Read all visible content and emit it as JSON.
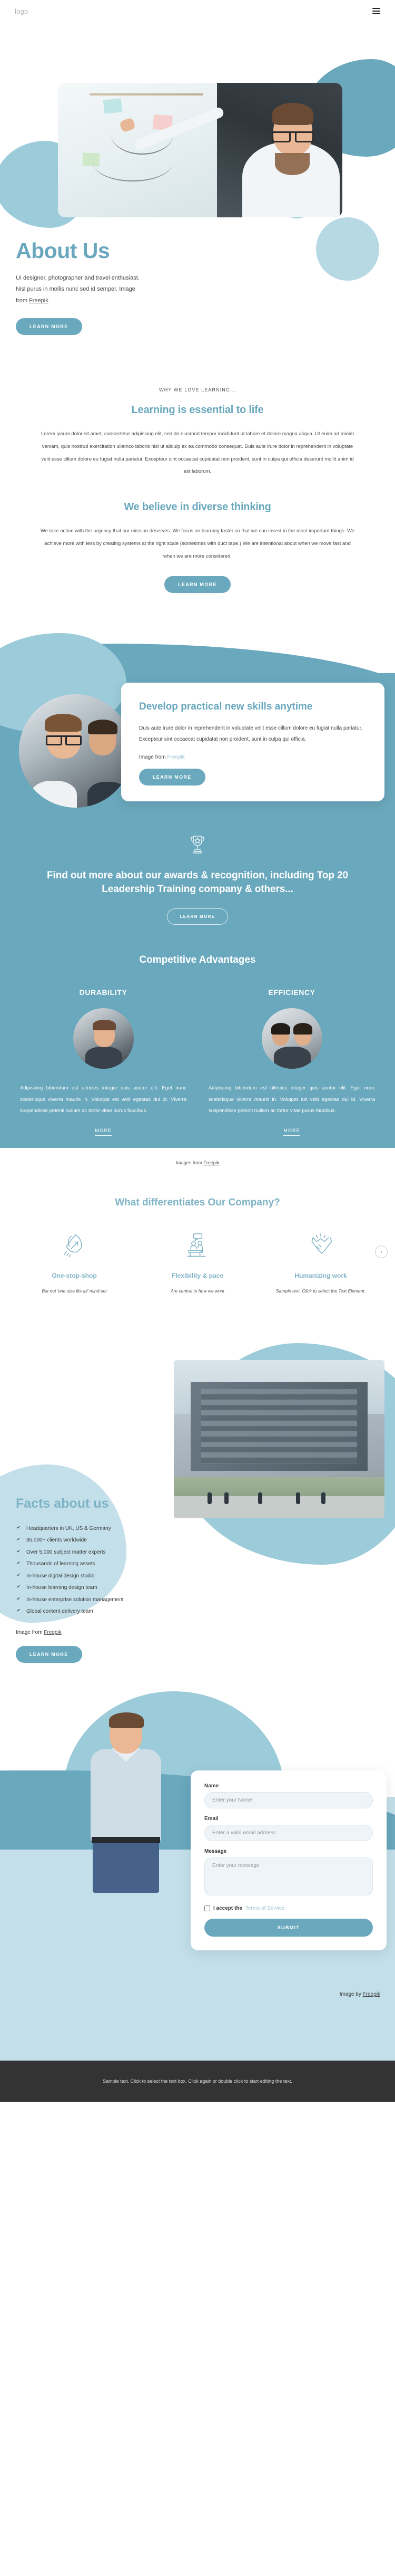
{
  "header": {
    "logo": "logo",
    "menu_icon": "hamburger-menu"
  },
  "hero": {
    "title": "About Us",
    "text_before_link": "UI designer, photographer and travel enthusiast. Nisl purus in mollis nunc sed id semper.  Image from ",
    "link": "Freepik",
    "cta": "LEARN MORE"
  },
  "why": {
    "eyebrow": "WHY WE LOVE LEARNING...",
    "title": "Learning is essential to life",
    "body": "Lorem ipsum dolor sit amet, consectetur adipiscing elit, sed do eiusmod tempor incididunt ut labore et dolore magna aliqua. Ut enim ad minim veniam, quis nostrud exercitation ullamco laboris nisi ut aliquip ex ea commodo consequat. Duis aute irure dolor in reprehenderit in voluptate velit esse cillum dolore eu fugiat nulla pariatur. Excepteur sint occaecat cupidatat non proident, sunt in culpa qui officia deserunt mollit anim id est laborum."
  },
  "believe": {
    "title": "We believe in diverse thinking",
    "body": "We take action with the urgency that our mission deserves. We focus on learning faster so that we can invest in the most important things. We achieve more with less by creating systems at the right scale (sometimes with duct tape.) We are intentional about when we move fast and when we are more considered.",
    "cta": "LEARN MORE"
  },
  "skills": {
    "title": "Develop practical new skills anytime",
    "body": "Duis aute irure dolor in reprehenderit in voluptate velit esse cillum dolore eu fugiat nulla pariatur. Excepteur sint occaecat cupidatat non proident, sunt in culpa qui officia.",
    "credit_prefix": "Image from ",
    "credit_link": "Freepik",
    "cta": "LEARN MORE"
  },
  "awards": {
    "icon": "trophy-icon",
    "title": "Find out more about our awards & recognition, including Top 20 Leadership Training company & others...",
    "cta": "LEARN MORE"
  },
  "competitive": {
    "title": "Competitive Advantages",
    "columns": [
      {
        "heading": "DURABILITY",
        "body": "Adipiscing bibendum est ultricies integer quis auctor elit. Eget nunc scelerisque viverra mauris in. Volutpat est velit egestas dui id. Viverra suspendisse potenti nullam ac tortor vitae purus faucibus.",
        "more": "MORE"
      },
      {
        "heading": "EFFICIENCY",
        "body": "Adipiscing bibendum est ultricies integer quis auctor elit. Eget nunc scelerisque viverra mauris in. Volutpat est velit egestas dui id. Viverra suspendisse potenti nullam ac tortor vitae purus faucibus.",
        "more": "MORE"
      }
    ],
    "credit_prefix": "Images from ",
    "credit_link": "Freepik"
  },
  "differentiates": {
    "title": "What differentiates Our Company?",
    "next_icon": "chevron-right-icon",
    "items": [
      {
        "icon": "rocket-icon",
        "title": "One-stop-shop",
        "text": "But not 'one size fits all' mind-set"
      },
      {
        "icon": "meeting-icon",
        "title": "Flexibility & pace",
        "text": "Are central to how we work"
      },
      {
        "icon": "handshake-icon",
        "title": "Humanizing work",
        "text": "Sample text. Click to select the Text Element."
      }
    ]
  },
  "facts": {
    "title": "Facts about us",
    "items": [
      "Headquarters in UK, US & Germany",
      "35,000+ clients worldwide",
      "Over 5,000 subject matter experts",
      "Thousands of learning assets",
      "In-house digital design studio",
      "In-house learning design team",
      "In-house enterprise solution management",
      "Global content delivery team"
    ],
    "credit_prefix": "Image from ",
    "credit_link": "Freepik",
    "cta": "LEARN MORE"
  },
  "contact": {
    "name_label": "Name",
    "name_placeholder": "Enter your Name",
    "name_value": "",
    "email_label": "Email",
    "email_placeholder": "Enter a valid email address",
    "email_value": "",
    "message_label": "Message",
    "message_placeholder": "Enter your message",
    "message_value": "",
    "terms_prefix": "I accept the ",
    "terms_link": "Terms of Service",
    "submit": "SUBMIT",
    "credit_prefix": "Image by ",
    "credit_link": "Freepik"
  },
  "footer": {
    "text": "Sample text. Click to select the text box. Click again or double click to start editing the text."
  },
  "colors": {
    "accent": "#6aa8bd",
    "accent_light": "#9ccbd9",
    "accent_pale": "#c3e0ea",
    "heading": "#68a7bd",
    "footer_bg": "#333333"
  }
}
